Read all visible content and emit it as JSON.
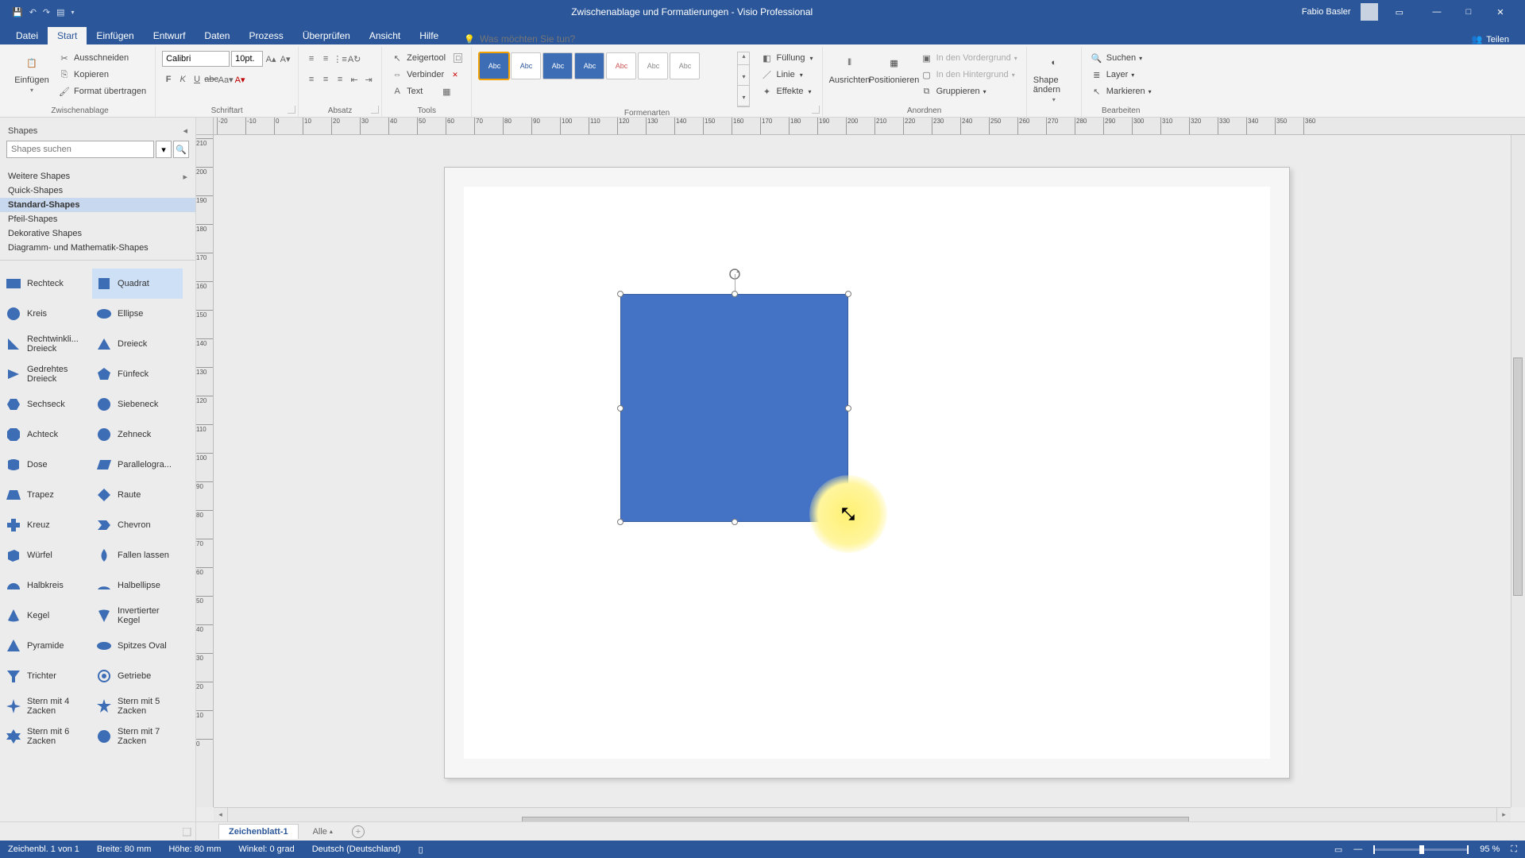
{
  "title_bar": {
    "doc_title": "Zwischenablage und Formatierungen  -  Visio Professional",
    "user": "Fabio Basler"
  },
  "menu": {
    "items": [
      "Datei",
      "Start",
      "Einfügen",
      "Entwurf",
      "Daten",
      "Prozess",
      "Überprüfen",
      "Ansicht",
      "Hilfe"
    ],
    "active": "Start",
    "tell_me_placeholder": "Was möchten Sie tun?",
    "share": "Teilen"
  },
  "ribbon": {
    "clipboard": {
      "label": "Zwischenablage",
      "paste": "Einfügen",
      "cut": "Ausschneiden",
      "copy": "Kopieren",
      "format_painter": "Format übertragen"
    },
    "font": {
      "label": "Schriftart",
      "name": "Calibri",
      "size": "10pt."
    },
    "paragraph": {
      "label": "Absatz"
    },
    "tools": {
      "label": "Tools",
      "pointer": "Zeigertool",
      "connector": "Verbinder",
      "text": "Text"
    },
    "styles": {
      "label": "Formenarten",
      "abc": "Abc",
      "fill": "Füllung",
      "line": "Linie",
      "effects": "Effekte"
    },
    "arrange": {
      "label": "Anordnen",
      "align": "Ausrichten",
      "position": "Positionieren",
      "front": "In den Vordergrund",
      "back": "In den Hintergrund",
      "group": "Gruppieren"
    },
    "change_shape": {
      "label": "Shape ändern"
    },
    "editing": {
      "label": "Bearbeiten",
      "find": "Suchen",
      "layer": "Layer",
      "select": "Markieren"
    }
  },
  "shapes_panel": {
    "title": "Shapes",
    "search_placeholder": "Shapes suchen",
    "stencils": {
      "more": "Weitere Shapes",
      "quick": "Quick-Shapes",
      "standard": "Standard-Shapes",
      "arrow": "Pfeil-Shapes",
      "deco": "Dekorative Shapes",
      "math": "Diagramm- und Mathematik-Shapes"
    },
    "shapes": [
      [
        "Rechteck",
        "Quadrat"
      ],
      [
        "Kreis",
        "Ellipse"
      ],
      [
        "Rechtwinkli... Dreieck",
        "Dreieck"
      ],
      [
        "Gedrehtes Dreieck",
        "Fünfeck"
      ],
      [
        "Sechseck",
        "Siebeneck"
      ],
      [
        "Achteck",
        "Zehneck"
      ],
      [
        "Dose",
        "Parallelogra..."
      ],
      [
        "Trapez",
        "Raute"
      ],
      [
        "Kreuz",
        "Chevron"
      ],
      [
        "Würfel",
        "Fallen lassen"
      ],
      [
        "Halbkreis",
        "Halbellipse"
      ],
      [
        "Kegel",
        "Invertierter Kegel"
      ],
      [
        "Pyramide",
        "Spitzes Oval"
      ],
      [
        "Trichter",
        "Getriebe"
      ],
      [
        "Stern mit 4 Zacken",
        "Stern mit 5 Zacken"
      ],
      [
        "Stern mit 6 Zacken",
        "Stern mit 7 Zacken"
      ]
    ],
    "selected": "Quadrat"
  },
  "ruler_h": [
    -20,
    -10,
    0,
    10,
    20,
    30,
    40,
    50,
    60,
    70,
    80,
    90,
    100,
    110,
    120,
    130,
    140,
    150,
    160,
    170,
    180,
    190,
    200,
    210,
    220,
    230,
    240,
    250,
    260,
    270,
    280,
    290,
    300,
    310,
    320,
    330,
    340,
    350,
    360
  ],
  "ruler_v": [
    210,
    200,
    190,
    180,
    170,
    160,
    150,
    140,
    130,
    120,
    110,
    100,
    90,
    80,
    70,
    60,
    50,
    40,
    30,
    20,
    10,
    0
  ],
  "sheet_tabs": {
    "sheet": "Zeichenblatt-1",
    "all": "Alle"
  },
  "status": {
    "page_info": "Zeichenbl. 1 von 1",
    "width": "Breite: 80 mm",
    "height": "Höhe: 80 mm",
    "angle": "Winkel: 0 grad",
    "lang": "Deutsch (Deutschland)",
    "zoom": "95 %"
  }
}
